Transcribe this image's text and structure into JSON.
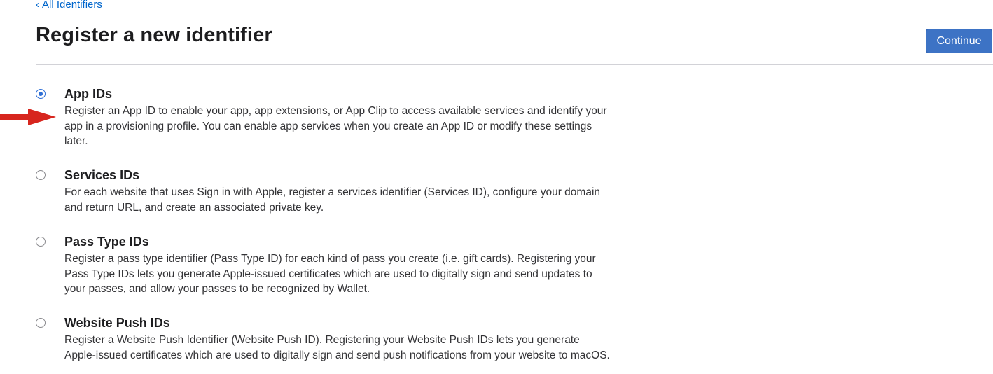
{
  "nav": {
    "back_chevron": "‹",
    "back_label": "All Identifiers"
  },
  "header": {
    "title": "Register a new identifier",
    "continue_label": "Continue"
  },
  "options": [
    {
      "title": "App IDs",
      "description": "Register an App ID to enable your app, app extensions, or App Clip to access available services and identify your app in a provisioning profile. You can enable app services when you create an App ID or modify these settings later.",
      "selected": true
    },
    {
      "title": "Services IDs",
      "description": "For each website that uses Sign in with Apple, register a services identifier (Services ID), configure your domain and return URL, and create an associated private key.",
      "selected": false
    },
    {
      "title": "Pass Type IDs",
      "description": "Register a pass type identifier (Pass Type ID) for each kind of pass you create (i.e. gift cards). Registering your Pass Type IDs lets you generate Apple-issued certificates which are used to digitally sign and send updates to your passes, and allow your passes to be recognized by Wallet.",
      "selected": false
    },
    {
      "title": "Website Push IDs",
      "description": "Register a Website Push Identifier (Website Push ID). Registering your Website Push IDs lets you generate Apple-issued certificates which are used to digitally sign and send push notifications from your website to macOS.",
      "selected": false
    }
  ],
  "annotation": {
    "arrow_color": "#d7261e",
    "points_to": "App IDs"
  },
  "colors": {
    "accent": "#3d73c5",
    "link": "#0066cc",
    "radio_selected": "#2f6fd6"
  }
}
